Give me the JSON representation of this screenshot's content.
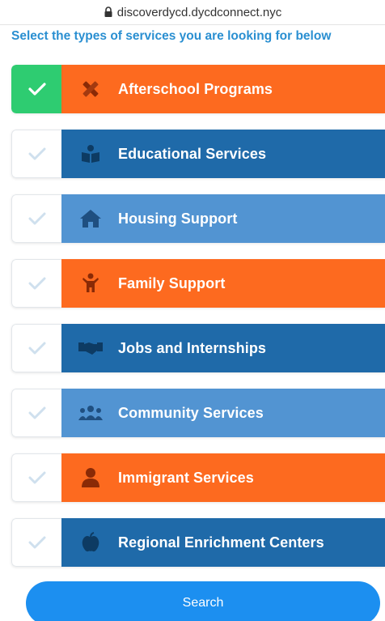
{
  "browser": {
    "url": "discoverdycd.dycdconnect.nyc"
  },
  "header": {
    "instructions": "Select the types of services you are looking for below"
  },
  "services": [
    {
      "label": "Afterschool Programs",
      "checked": true,
      "color": "#fd6a1f",
      "icon": "pencil-ruler-icon"
    },
    {
      "label": "Educational Services",
      "checked": false,
      "color": "#1f6aa9",
      "icon": "book-reader-icon"
    },
    {
      "label": "Housing Support",
      "checked": false,
      "color": "#5294d2",
      "icon": "home-icon"
    },
    {
      "label": "Family Support",
      "checked": false,
      "color": "#fd6a1f",
      "icon": "child-icon"
    },
    {
      "label": "Jobs and Internships",
      "checked": false,
      "color": "#1f6aa9",
      "icon": "handshake-icon"
    },
    {
      "label": "Community Services",
      "checked": false,
      "color": "#5294d2",
      "icon": "users-icon"
    },
    {
      "label": "Immigrant Services",
      "checked": false,
      "color": "#fd6a1f",
      "icon": "person-icon"
    },
    {
      "label": "Regional Enrichment Centers",
      "checked": false,
      "color": "#1f6aa9",
      "icon": "apple-icon"
    }
  ],
  "colors": {
    "checked_green": "#2ecc71",
    "check_inactive": "#cfe0ee",
    "search_blue": "#1c8ff0",
    "instruction_blue": "#2a8fd1"
  },
  "search": {
    "label": "Search"
  }
}
